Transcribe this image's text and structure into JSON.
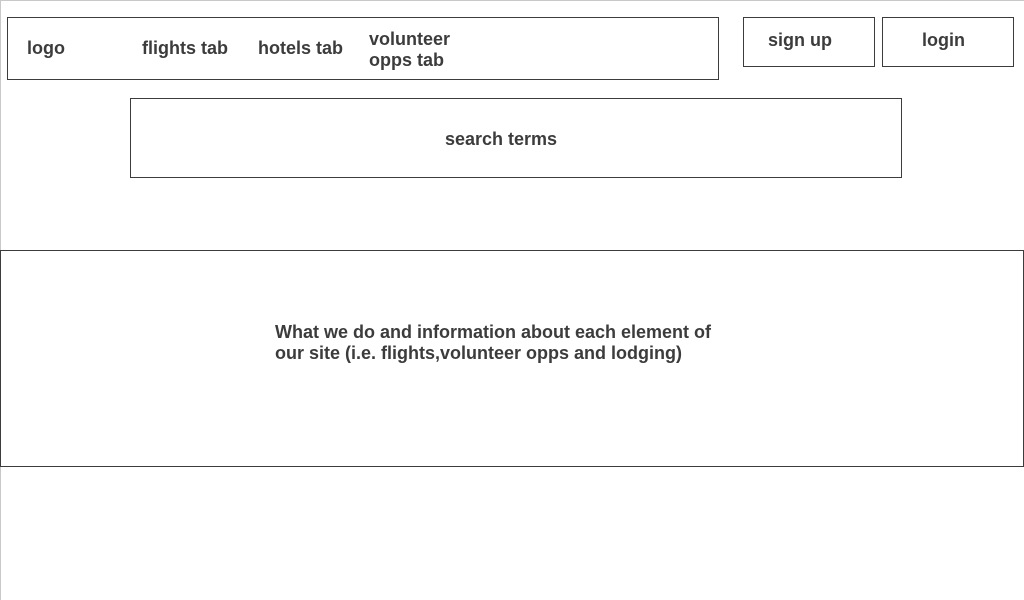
{
  "nav": {
    "logo": "logo",
    "tabs": {
      "flights": "flights tab",
      "hotels": "hotels tab",
      "volunteer_line1": "volunteer",
      "volunteer_line2": "opps tab"
    }
  },
  "account": {
    "signup_label": "sign up",
    "login_label": "login"
  },
  "search": {
    "placeholder": "search terms"
  },
  "info": {
    "line1": "What we do and information about each element of",
    "line2": "our site (i.e. flights,volunteer opps and lodging)"
  }
}
